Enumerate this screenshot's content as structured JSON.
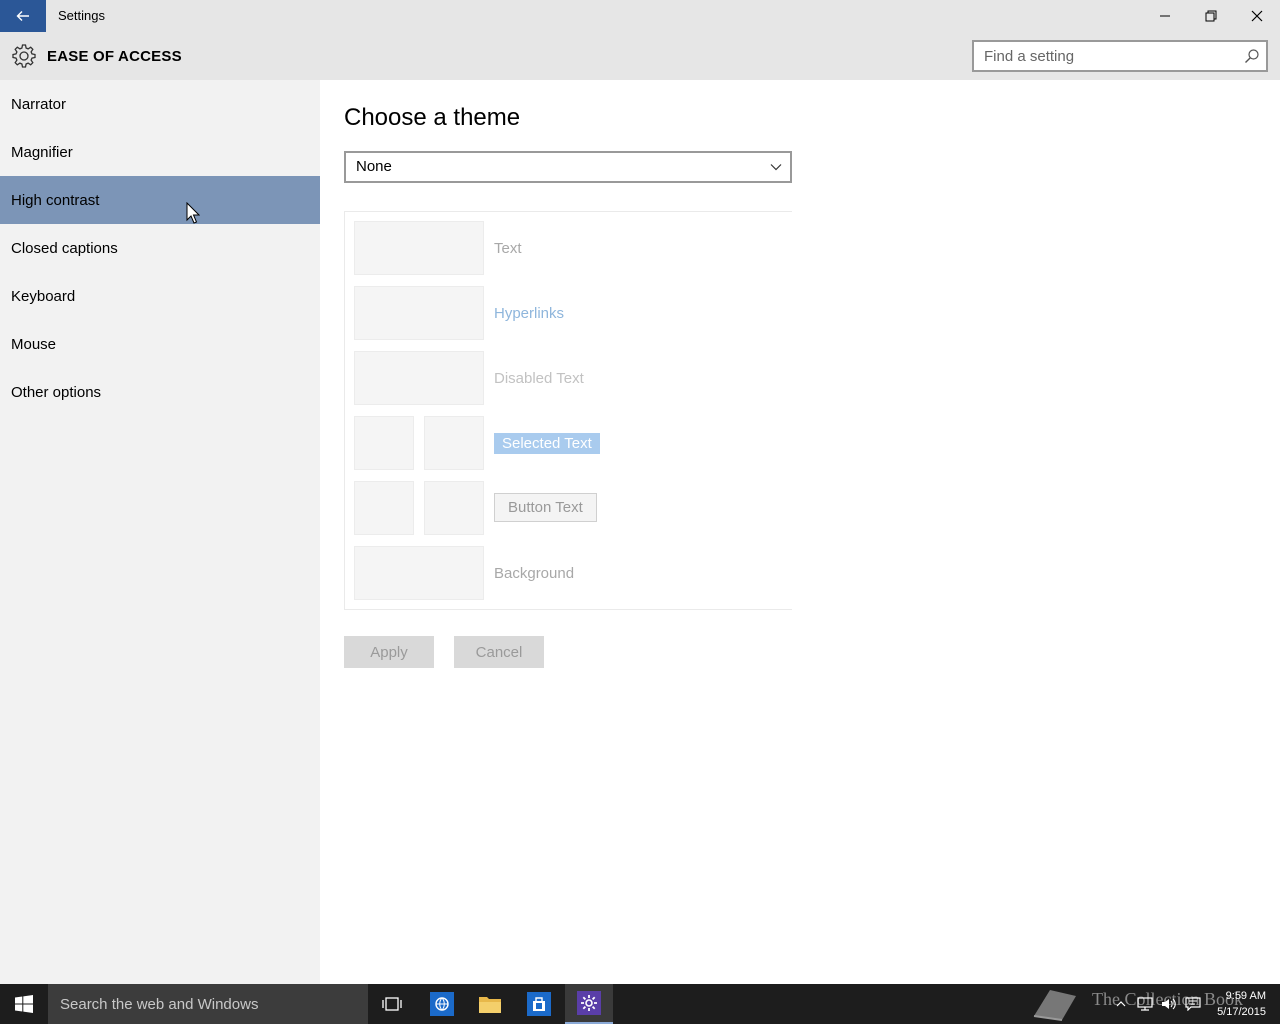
{
  "window": {
    "title": "Settings",
    "controls": {
      "minimize": "minimize-icon",
      "maximize": "restore-icon",
      "close": "close-icon"
    }
  },
  "header": {
    "section_title": "EASE OF ACCESS",
    "icon": "gear-icon",
    "search_placeholder": "Find a setting"
  },
  "sidebar": {
    "items": [
      {
        "label": "Narrator"
      },
      {
        "label": "Magnifier"
      },
      {
        "label": "High contrast",
        "active": true
      },
      {
        "label": "Closed captions"
      },
      {
        "label": "Keyboard"
      },
      {
        "label": "Mouse"
      },
      {
        "label": "Other options"
      }
    ]
  },
  "main": {
    "page_title": "Choose a theme",
    "theme_select": {
      "value": "None"
    },
    "preview": {
      "text": "Text",
      "hyperlinks": "Hyperlinks",
      "disabled_text": "Disabled Text",
      "selected_text": "Selected Text",
      "button_text": "Button Text",
      "background": "Background"
    },
    "apply_label": "Apply",
    "cancel_label": "Cancel"
  },
  "taskbar": {
    "search_placeholder": "Search the web and Windows",
    "watermark": "The Collection Book",
    "time": "9:59 AM",
    "date": "5/17/2015"
  },
  "colors": {
    "accent": "#2b5797",
    "active_nav": "#7c95b7",
    "taskbar": "#1d1d1d"
  }
}
